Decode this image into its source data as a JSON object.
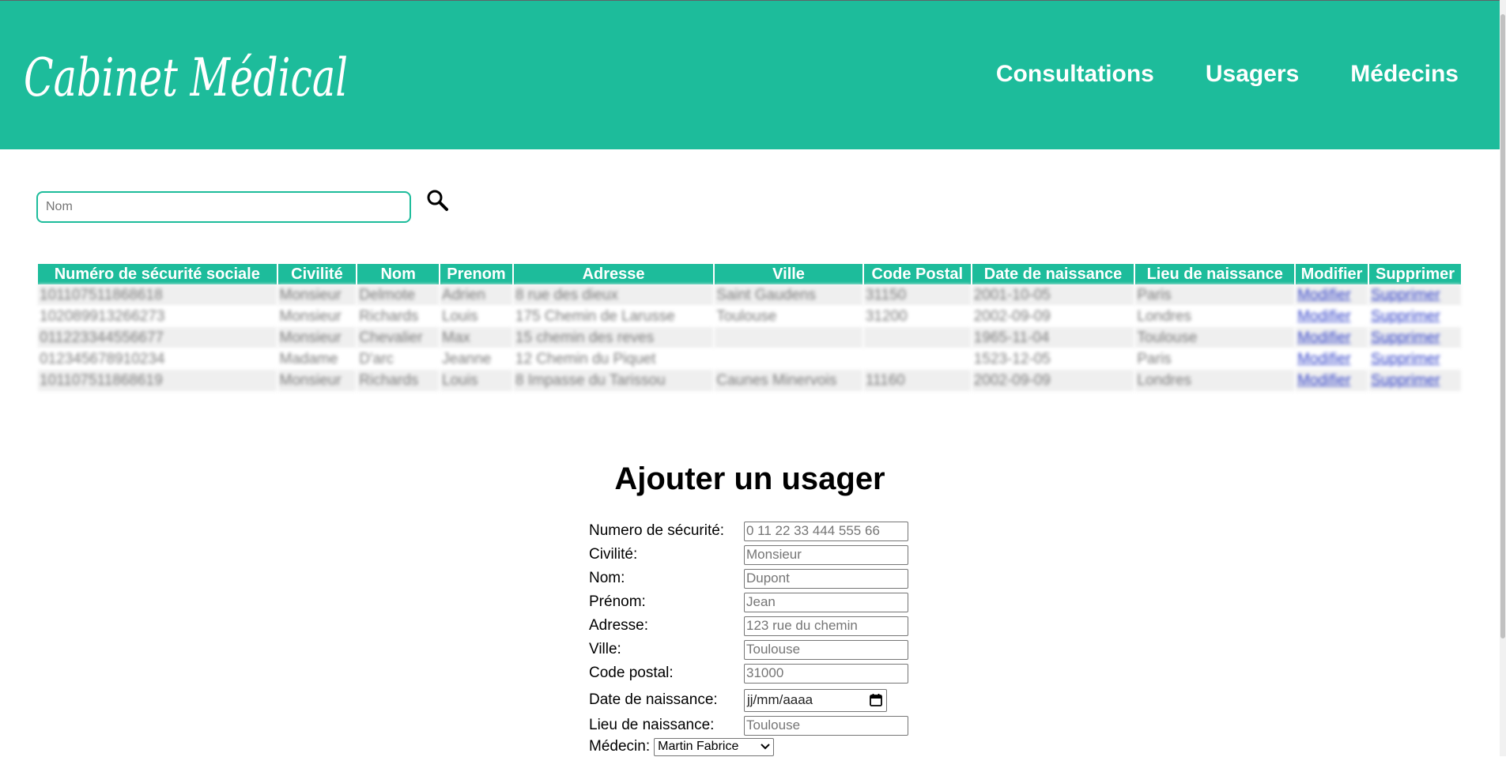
{
  "header": {
    "logo_text": "Cabinet Médical",
    "nav": [
      {
        "label": "Consultations"
      },
      {
        "label": "Usagers"
      },
      {
        "label": "Médecins"
      }
    ],
    "background_color": "#1dbc9b"
  },
  "search": {
    "placeholder": "Nom",
    "icon": "search-icon"
  },
  "table": {
    "columns": [
      "Numéro de sécurité sociale",
      "Civilité",
      "Nom",
      "Prenom",
      "Adresse",
      "Ville",
      "Code Postal",
      "Date de naissance",
      "Lieu de naissance",
      "Modifier",
      "Supprimer"
    ],
    "rows": [
      {
        "nss": "101107511868618",
        "civilite": "Monsieur",
        "nom": "Delmote",
        "prenom": "Adrien",
        "adresse": "8 rue des dieux",
        "ville": "Saint Gaudens",
        "cp": "31150",
        "date": "2001-10-05",
        "lieu": "Paris",
        "modifier": "Modifier",
        "supprimer": "Supprimer"
      },
      {
        "nss": "102089913266273",
        "civilite": "Monsieur",
        "nom": "Richards",
        "prenom": "Louis",
        "adresse": "175 Chemin de Larusse",
        "ville": "Toulouse",
        "cp": "31200",
        "date": "2002-09-09",
        "lieu": "Londres",
        "modifier": "Modifier",
        "supprimer": "Supprimer"
      },
      {
        "nss": "011223344556677",
        "civilite": "Monsieur",
        "nom": "Chevalier",
        "prenom": "Max",
        "adresse": "15 chemin des reves",
        "ville": "",
        "cp": "",
        "date": "1965-11-04",
        "lieu": "Toulouse",
        "modifier": "Modifier",
        "supprimer": "Supprimer"
      },
      {
        "nss": "012345678910234",
        "civilite": "Madame",
        "nom": "D'arc",
        "prenom": "Jeanne",
        "adresse": "12 Chemin du Piquet",
        "ville": "",
        "cp": "",
        "date": "1523-12-05",
        "lieu": "Paris",
        "modifier": "Modifier",
        "supprimer": "Supprimer"
      },
      {
        "nss": "101107511868619",
        "civilite": "Monsieur",
        "nom": "Richards",
        "prenom": "Louis",
        "adresse": "8 Impasse du Tarissou",
        "ville": "Caunes Minervois",
        "cp": "11160",
        "date": "2002-09-09",
        "lieu": "Londres",
        "modifier": "Modifier",
        "supprimer": "Supprimer"
      }
    ]
  },
  "form": {
    "title": "Ajouter un usager",
    "fields": [
      {
        "label": "Numero de sécurité:",
        "placeholder": "0 11 22 33 444 555 66"
      },
      {
        "label": "Civilité:",
        "placeholder": "Monsieur"
      },
      {
        "label": "Nom:",
        "placeholder": "Dupont"
      },
      {
        "label": "Prénom:",
        "placeholder": "Jean"
      },
      {
        "label": "Adresse:",
        "placeholder": "123 rue du chemin"
      },
      {
        "label": "Ville:",
        "placeholder": "Toulouse"
      },
      {
        "label": "Code postal:",
        "placeholder": "31000"
      }
    ],
    "date_field": {
      "label": "Date de naissance:",
      "value": "jj/mm/aaaa"
    },
    "lieu_field": {
      "label": "Lieu de naissance:",
      "placeholder": "Toulouse"
    },
    "medecin_field": {
      "label": "Médecin:",
      "value": "Martin Fabrice"
    }
  }
}
